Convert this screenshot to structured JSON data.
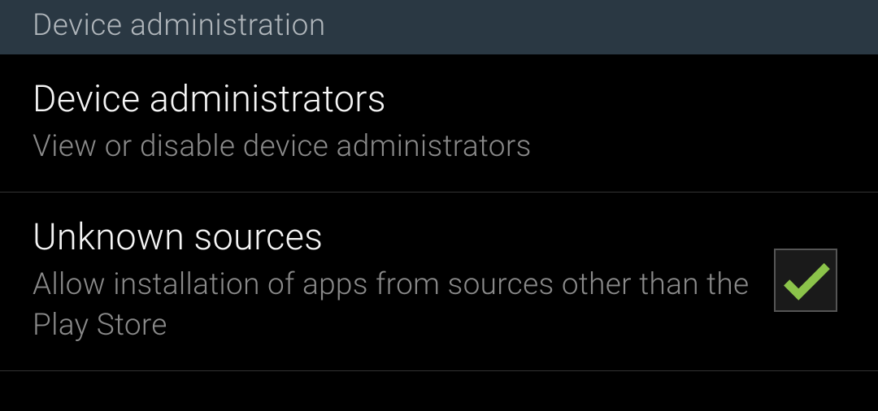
{
  "section": {
    "header": "Device administration"
  },
  "items": [
    {
      "title": "Device administrators",
      "subtitle": "View or disable device administrators"
    },
    {
      "title": "Unknown sources",
      "subtitle": "Allow installation of apps from sources other than the Play Store",
      "checked": true
    }
  ],
  "colors": {
    "checkmark": "#8bc34a"
  }
}
